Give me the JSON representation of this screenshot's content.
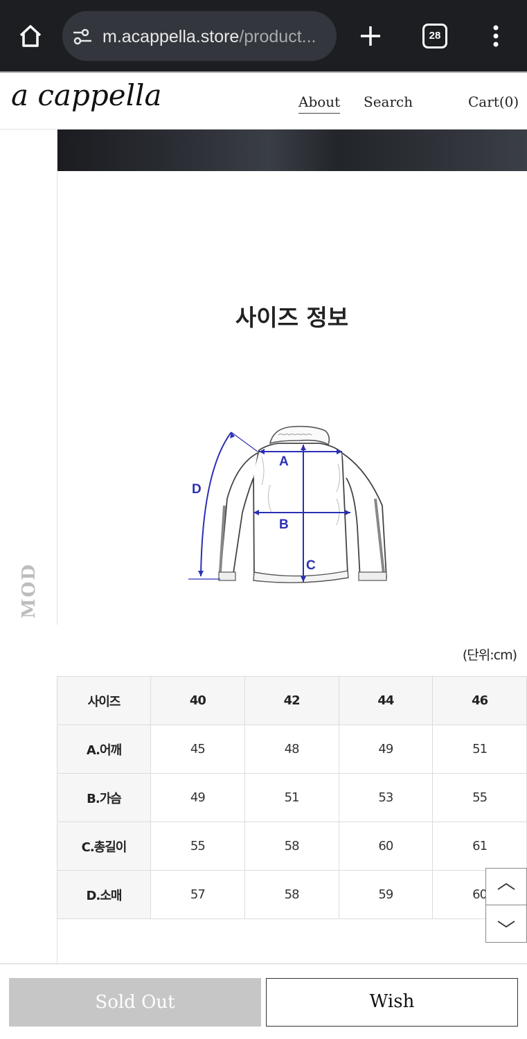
{
  "browser": {
    "url_main": "m.acappella.store",
    "url_rest": "/product...",
    "tab_count": "28",
    "icons": [
      "home-icon",
      "site-settings-icon",
      "new-tab-icon",
      "tab-switcher-icon",
      "more-menu-icon"
    ]
  },
  "site": {
    "logo": "a cappella",
    "nav": {
      "about": "About",
      "search": "Search",
      "cart": "Cart(0)"
    },
    "side_label": "MOD"
  },
  "content": {
    "title": "사이즈 정보",
    "diagram_labels": {
      "a": "A",
      "b": "B",
      "c": "C",
      "d": "D"
    },
    "unit": "(단위:cm)"
  },
  "size_table": {
    "header": [
      "사이즈",
      "40",
      "42",
      "44",
      "46"
    ],
    "rows": [
      [
        "A.어깨",
        "45",
        "48",
        "49",
        "51"
      ],
      [
        "B.가슴",
        "49",
        "51",
        "53",
        "55"
      ],
      [
        "C.총길이",
        "55",
        "58",
        "60",
        "61"
      ],
      [
        "D.소매",
        "57",
        "58",
        "59",
        "60"
      ]
    ]
  },
  "bottom_bar": {
    "sold_out": "Sold Out",
    "wish": "Wish"
  },
  "colors": {
    "chrome_bg": "#1c1e22",
    "diagram_blue": "#2b2fb3",
    "sold_out_bg": "#c6c6c6"
  }
}
